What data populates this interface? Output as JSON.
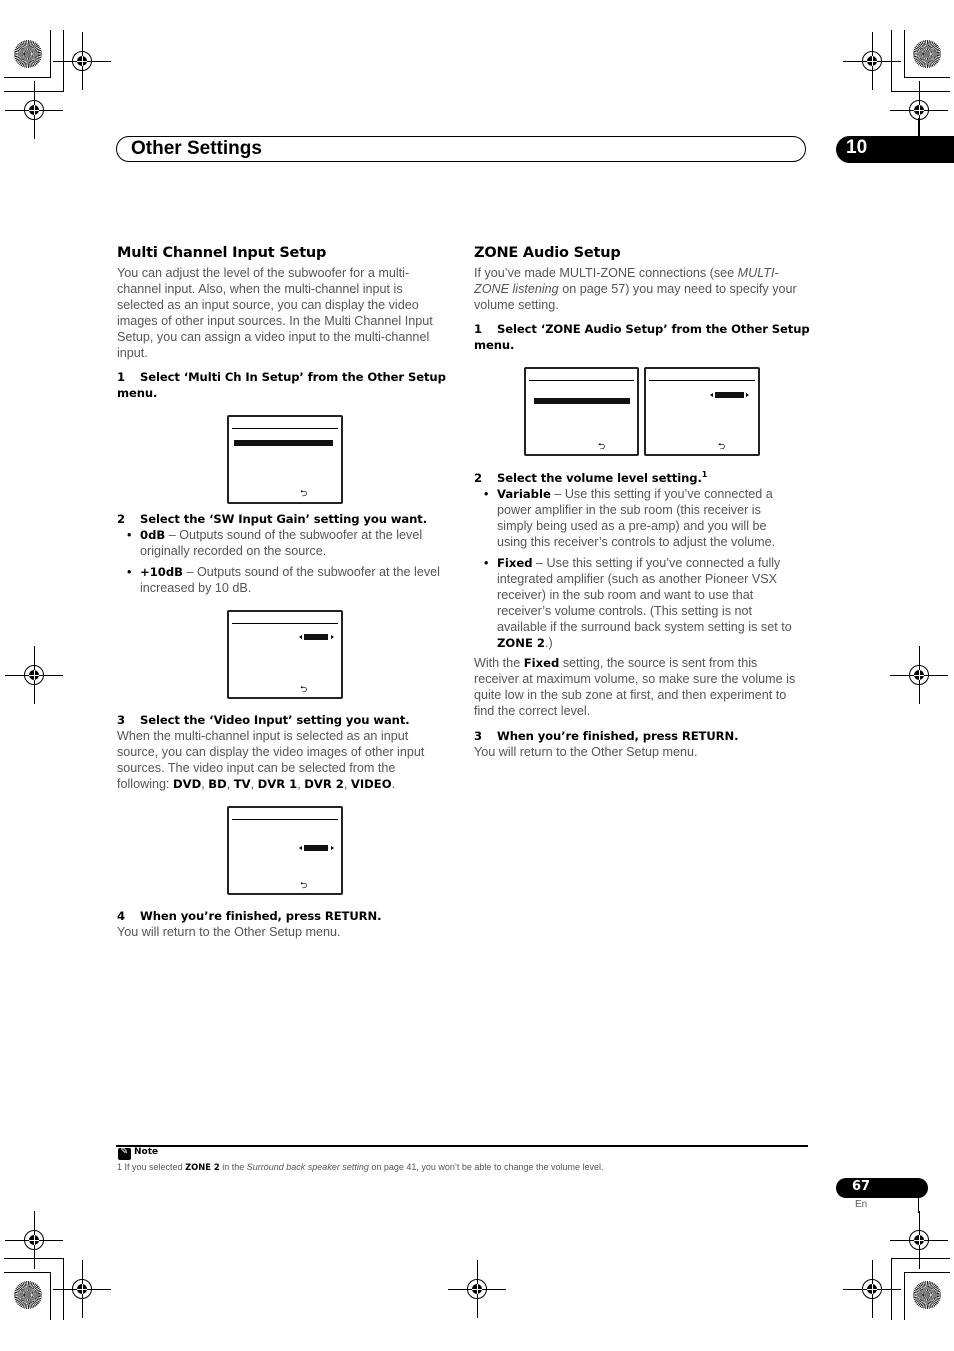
{
  "header": {
    "section_title": "Other Settings",
    "chapter_number": "10"
  },
  "left_column": {
    "heading": "Multi Channel Input Setup",
    "intro_lines": [
      "You can adjust the level of the subwoofer for a multi-",
      "channel input. Also, when the multi-channel input is",
      "selected as an input source, you can display the video",
      "images of other input sources. In the Multi Channel Input",
      "Setup, you can assign a video input to the multi-channel",
      "input."
    ],
    "step1": {
      "number": "1",
      "text_line1": "Select ‘Multi Ch In Setup’ from the Other Setup",
      "text_line2": "menu."
    },
    "step2": {
      "number": "2",
      "text": "Select the ‘SW Input Gain’ setting you want.",
      "bullets": [
        {
          "term": "0dB",
          "desc_line1": " – Outputs sound of the subwoofer at the level",
          "desc_line2": "originally recorded on the source."
        },
        {
          "term": "+10dB",
          "desc_line1": " – Outputs sound of the subwoofer at the level",
          "desc_line2": "increased by 10 dB."
        }
      ]
    },
    "step3": {
      "number": "3",
      "text": "Select the ‘Video Input’ setting you want.",
      "body_lines": [
        "When the multi-channel input is selected as an input",
        "source, you can display the video images of other input",
        "sources. The video input can be selected from the"
      ],
      "following_label": "following: ",
      "options": [
        "DVD",
        "BD",
        "TV",
        "DVR 1",
        "DVR 2",
        "VIDEO"
      ],
      "sep": ", ",
      "end": "."
    },
    "step4": {
      "number": "4",
      "text": "When you’re finished, press RETURN.",
      "body": "You will return to the Other Setup menu."
    }
  },
  "right_column": {
    "heading": "ZONE Audio Setup",
    "intro": {
      "line1_a": "If you’ve made MULTI-ZONE connections (see ",
      "line1_i": "MULTI-",
      "line2_i": "ZONE listening",
      "line2_b": " on page 57) you may need to specify your",
      "line3": "volume setting."
    },
    "step1": {
      "number": "1",
      "text_line1": "Select ‘ZONE Audio Setup’ from the Other Setup",
      "text_line2": "menu."
    },
    "step2": {
      "number": "2",
      "text": "Select the volume level setting.",
      "footnote_ref": "1",
      "bullets": [
        {
          "term": "Variable",
          "lines": [
            " – Use this setting if you’ve connected a",
            "power amplifier in the sub room (this receiver is",
            "simply being used as a pre-amp) and you will be",
            "using this receiver’s controls to adjust the volume."
          ]
        },
        {
          "term": "Fixed",
          "lines": [
            " – Use this setting if you’ve connected a fully",
            "integrated amplifier (such as another Pioneer VSX",
            "receiver) in the sub room and want to use that",
            "receiver’s volume controls. (This setting is not",
            "available if the surround back system setting is set to"
          ],
          "tail_bold": "ZONE 2",
          "tail_end": ".)"
        }
      ]
    },
    "fixed_note": {
      "lead": "With the ",
      "bold": "Fixed",
      "line1_rest": " setting, the source is sent from this",
      "lines": [
        "receiver at maximum volume, so make sure the volume is",
        "quite low in the sub zone at first, and then experiment to",
        "find the correct level."
      ]
    },
    "step3": {
      "number": "3",
      "text": "When you’re finished, press RETURN.",
      "body": "You will return to the Other Setup menu."
    }
  },
  "screens": {
    "return_glyph": "⮌"
  },
  "footer": {
    "note_label": "Note",
    "note_number": "1",
    "note_a": " If you selected ",
    "note_bold": "ZONE 2",
    "note_b": " in the ",
    "note_italic": "Surround back speaker setting",
    "note_c": " on page 41, you won’t be able to change the volume level.",
    "page_number": "67",
    "language": "En"
  }
}
